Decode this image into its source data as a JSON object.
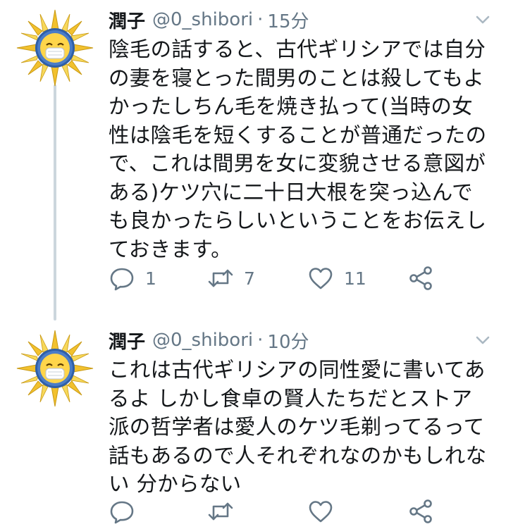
{
  "tweets": [
    {
      "name": "潤子",
      "handle": "@0_shibori",
      "separator": "·",
      "time": "15分",
      "lines": [
        "陰毛の話すると、古代ギリシアでは自分",
        "の妻を寝とった間男のことは殺してもよ",
        "かったしちん毛を焼き払って(当時の女",
        "性は陰毛を短くすることが普通だったの",
        "で、これは間男を女に変貌させる意図が",
        "ある)ケツ穴に二十日大根を突っ込んで",
        "も良かったらしいということをお伝えし",
        "ておきます。"
      ],
      "counts": {
        "reply": "1",
        "retweet": "7",
        "like": "11"
      }
    },
    {
      "name": "潤子",
      "handle": "@0_shibori",
      "separator": "·",
      "time": "10分",
      "lines": [
        "これは古代ギリシアの同性愛に書いてあ",
        "るよ しかし食卓の賢人たちだとストア",
        "派の哲学者は愛人のケツ毛剃ってるって",
        "話もあるので人それぞれなのかもしれな",
        "い 分からない"
      ],
      "counts": {
        "reply": "",
        "retweet": "",
        "like": ""
      }
    }
  ],
  "icons": {
    "reply": "reply-icon",
    "retweet": "retweet-icon",
    "like": "heart-icon",
    "share": "share-icon",
    "menu": "chevron-down-icon",
    "avatar": "sun-mask-avatar"
  },
  "colors": {
    "text": "#14171a",
    "muted": "#657786",
    "thread_line": "#ccd6dd",
    "avatar_sun": "#f2c12e",
    "avatar_ring": "#2f5fa7"
  }
}
